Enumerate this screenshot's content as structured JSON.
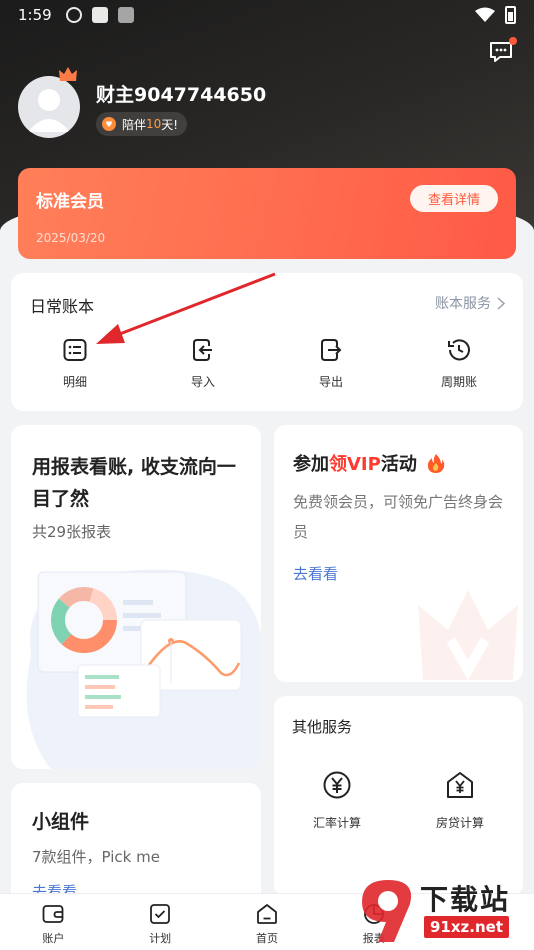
{
  "status_bar": {
    "time": "1:59"
  },
  "profile": {
    "name": "财主9047744650",
    "companion_prefix": "陪伴",
    "companion_days": "10",
    "companion_suffix": "天!"
  },
  "membership": {
    "title": "标准会员",
    "date": "2025/03/20",
    "detail_label": "查看详情"
  },
  "daily_book": {
    "title": "日常账本",
    "service_label": "账本服务",
    "items": [
      {
        "label": "明细",
        "icon": "list-icon"
      },
      {
        "label": "导入",
        "icon": "import-icon"
      },
      {
        "label": "导出",
        "icon": "export-icon"
      },
      {
        "label": "周期账",
        "icon": "cycle-clock-icon"
      }
    ]
  },
  "report_card": {
    "heading": "用报表看账, 收支流向一目了然",
    "subtitle": "共29张报表"
  },
  "vip_activity": {
    "heading_prefix": "参加",
    "heading_highlight": "领VIP",
    "heading_suffix": "活动",
    "description": "免费领会员，可领免广告终身会员",
    "action": "去看看"
  },
  "other_services": {
    "title": "其他服务",
    "items": [
      {
        "label": "汇率计算",
        "icon": "yen-circle-icon"
      },
      {
        "label": "房贷计算",
        "icon": "house-yen-icon"
      }
    ]
  },
  "widget_card": {
    "heading": "小组件",
    "subtitle": "7款组件，Pick me",
    "action": "去看看"
  },
  "tabbar": {
    "tabs": [
      {
        "label": "账户"
      },
      {
        "label": "计划"
      },
      {
        "label": "首页"
      },
      {
        "label": "报表"
      }
    ]
  },
  "watermark": {
    "title": "下载站",
    "url": "91xz.net"
  },
  "colors": {
    "accent_red": "#ff5a46",
    "link_blue": "#4a78d0",
    "annotation_red": "#e0272b"
  }
}
